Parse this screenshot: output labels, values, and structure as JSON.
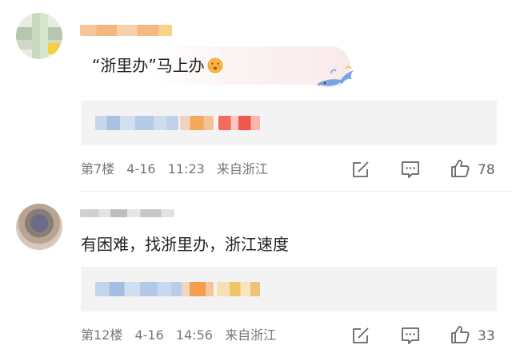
{
  "comments": [
    {
      "text_part": "“浙里办”马上办",
      "emoji_icon": "heart-eyes-kiss-emoji-icon",
      "sticker_icon": "whale-sticker-icon",
      "meta": {
        "floor": "第7楼",
        "date": "4-16",
        "time": "11:23",
        "location": "来自浙江"
      },
      "likes": "78"
    },
    {
      "text_part": "有困难，找浙里办，浙江速度",
      "meta": {
        "floor": "第12楼",
        "date": "4-16",
        "time": "14:56",
        "location": "来自浙江"
      },
      "likes": "33"
    }
  ],
  "colors": {
    "text": "#222222",
    "meta": "#777777",
    "reply_bg": "#f3f3f3",
    "icon": "#666666"
  }
}
